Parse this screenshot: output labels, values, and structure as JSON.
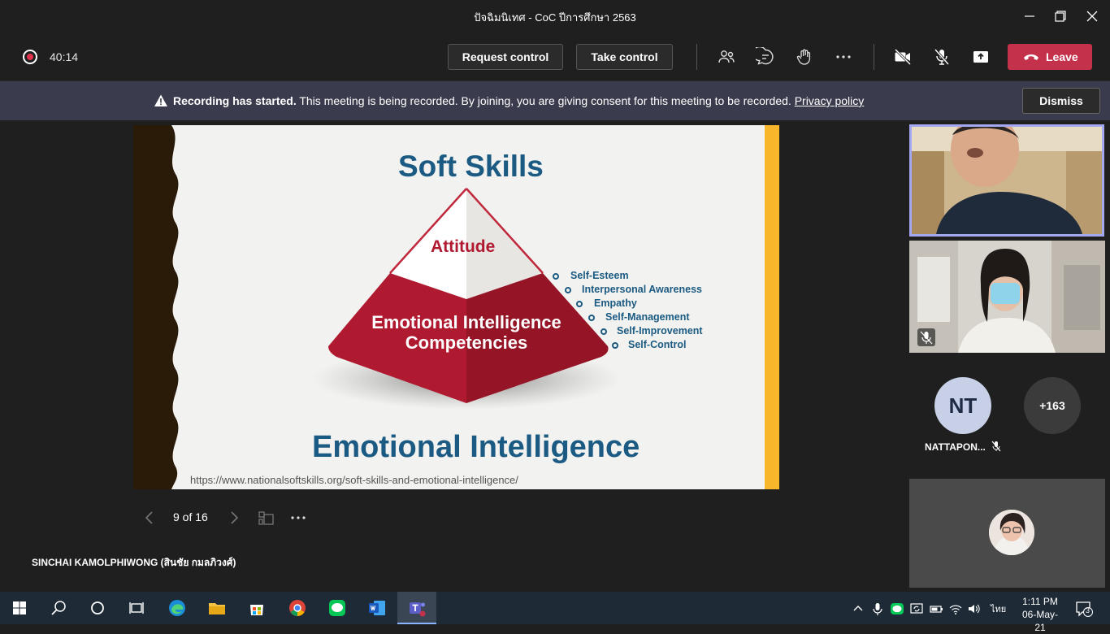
{
  "window": {
    "title": "ปัจฉิมนิเทศ - CoC ปีการศึกษา 2563"
  },
  "toolbar": {
    "timer": "40:14",
    "request_control": "Request control",
    "take_control": "Take control",
    "leave": "Leave",
    "icons": [
      "participants-icon",
      "chat-icon",
      "raise-hand-icon",
      "more-icon",
      "camera-off-icon",
      "mic-off-icon",
      "share-icon"
    ]
  },
  "banner": {
    "bold": "Recording has started.",
    "text": " This meeting is being recorded. By joining, you are giving consent for this meeting to be recorded. ",
    "link": "Privacy policy",
    "dismiss": "Dismiss"
  },
  "slide": {
    "title": "Soft Skills",
    "top_label": "Attitude",
    "base_label_1": "Emotional Intelligence",
    "base_label_2": "Competencies",
    "skills": [
      "Self-Esteem",
      "Interpersonal Awareness",
      "Empathy",
      "Self-Management",
      "Self-Improvement",
      "Self-Control"
    ],
    "footer_title": "Emotional Intelligence",
    "url": "https://www.nationalsoftskills.org/soft-skills-and-emotional-intelligence/",
    "colors": {
      "accent_blue": "#1b5a82",
      "pyramid_red": "#b01a30",
      "side_bar": "#f8b62b"
    }
  },
  "pager": {
    "text": "9 of 16"
  },
  "presenter": {
    "name": "SINCHAI KAMOLPHIWONG (สินชัย กมลภิวงศ์)"
  },
  "participants": {
    "nt_initials": "NT",
    "nt_name": "NATTAPON...",
    "more_count": "+163"
  },
  "taskbar": {
    "apps": [
      "windows-start-icon",
      "search-icon",
      "cortana-icon",
      "task-view-icon",
      "edge-icon",
      "file-explorer-icon",
      "store-icon",
      "chrome-icon",
      "line-icon",
      "word-icon",
      "teams-icon"
    ],
    "language": "ไทย",
    "time": "1:11 PM",
    "date": "06-May-21",
    "notifications": "3"
  }
}
